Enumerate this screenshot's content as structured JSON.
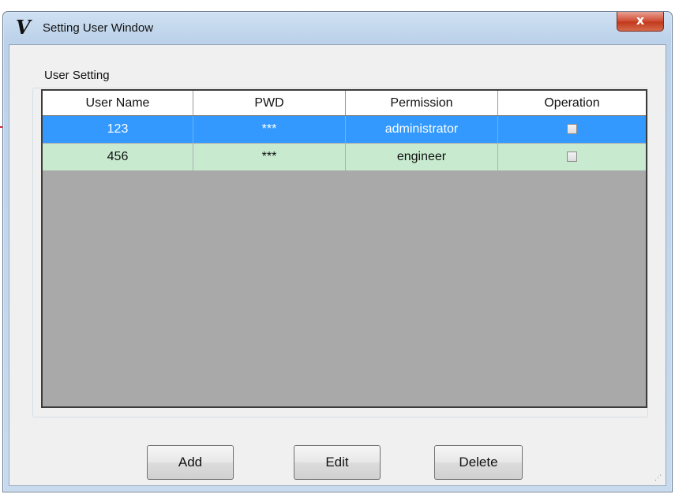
{
  "window": {
    "title": "Setting User Window",
    "close_glyph": "x",
    "app_icon_glyph": "V"
  },
  "group": {
    "legend": "User Setting"
  },
  "table": {
    "columns": [
      "User Name",
      "PWD",
      "Permission",
      "Operation"
    ],
    "rows": [
      {
        "user_name": "123",
        "pwd": "***",
        "permission": "administrator",
        "operation_checked": false,
        "selected": true
      },
      {
        "user_name": "456",
        "pwd": "***",
        "permission": "engineer",
        "operation_checked": false,
        "selected": false
      }
    ]
  },
  "buttons": {
    "add": "Add",
    "edit": "Edit",
    "delete": "Delete"
  },
  "colors": {
    "selected_row": "#3399ff",
    "normal_row": "#c8ebcf",
    "grid_background": "#a9a9a9",
    "close_button": "#c23a1e"
  }
}
